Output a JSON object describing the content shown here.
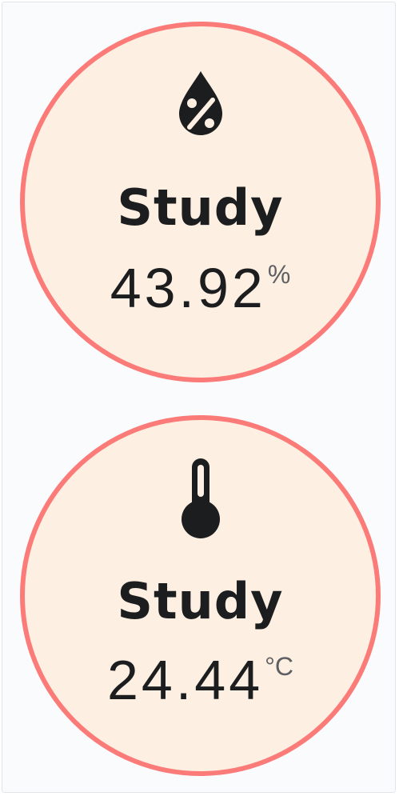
{
  "colors": {
    "bubble_fill": "#fdefe1",
    "bubble_ring": "#fb7b79",
    "text": "#1c1d1f",
    "unit_text": "#5d5f63"
  },
  "sensors": [
    {
      "icon": "water-percent-icon",
      "name": "Study",
      "value": "43.92",
      "unit": "%"
    },
    {
      "icon": "thermometer-icon",
      "name": "Study",
      "value": "24.44",
      "unit": "°C"
    }
  ]
}
